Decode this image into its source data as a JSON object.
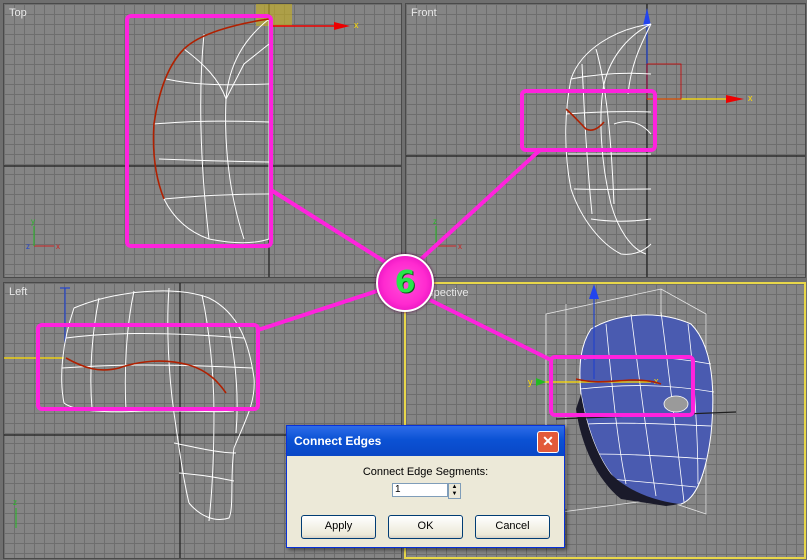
{
  "viewports": {
    "top": {
      "label": "Top"
    },
    "front": {
      "label": "Front"
    },
    "left": {
      "label": "Left"
    },
    "perspective": {
      "label": "Perspective"
    }
  },
  "axes": {
    "x": "x",
    "y": "y",
    "z": "z"
  },
  "step_badge": {
    "number": "6",
    "color": "#ff2ad0",
    "text_color": "#27e64a"
  },
  "colors": {
    "highlight": "#ff22dd",
    "active_viewport_border": "#e8d74a",
    "edge_selection": "#cc2200",
    "mesh": "#ffffff",
    "perspective_mesh": "#3d4fa8"
  },
  "dialog": {
    "title": "Connect Edges",
    "segments_label": "Connect Edge Segments:",
    "segments_value": "1",
    "apply_label": "Apply",
    "ok_label": "OK",
    "cancel_label": "Cancel",
    "close_icon": "close-icon"
  }
}
